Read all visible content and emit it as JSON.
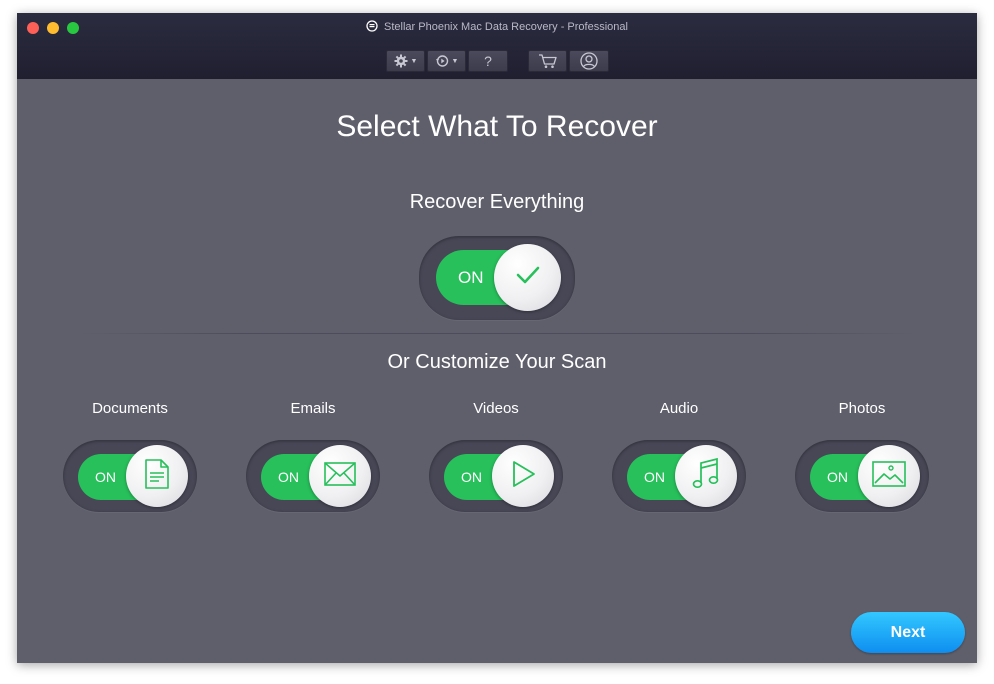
{
  "window": {
    "title": "Stellar Phoenix Mac Data Recovery - Professional"
  },
  "toolbar": {
    "buttons": [
      {
        "icon": "gear-icon",
        "has_menu": true
      },
      {
        "icon": "history-icon",
        "has_menu": true
      },
      {
        "icon": "help-icon",
        "label": "?"
      },
      {
        "icon": "cart-icon"
      },
      {
        "icon": "user-icon"
      }
    ]
  },
  "main": {
    "heading": "Select What To Recover",
    "recover_everything": {
      "label": "Recover Everything",
      "state": "ON",
      "icon": "checkmark-icon"
    },
    "customize_heading": "Or Customize Your Scan",
    "categories": [
      {
        "label": "Documents",
        "state": "ON",
        "icon": "document-icon"
      },
      {
        "label": "Emails",
        "state": "ON",
        "icon": "envelope-icon"
      },
      {
        "label": "Videos",
        "state": "ON",
        "icon": "play-icon"
      },
      {
        "label": "Audio",
        "state": "ON",
        "icon": "music-note-icon"
      },
      {
        "label": "Photos",
        "state": "ON",
        "icon": "image-icon"
      }
    ]
  },
  "footer": {
    "next_label": "Next"
  },
  "colors": {
    "background": "#5f5f6c",
    "titlebar": "#252537",
    "toggle_on": "#27c05b",
    "icon_green": "#27c05b",
    "next_button": "#1aa8f7"
  }
}
